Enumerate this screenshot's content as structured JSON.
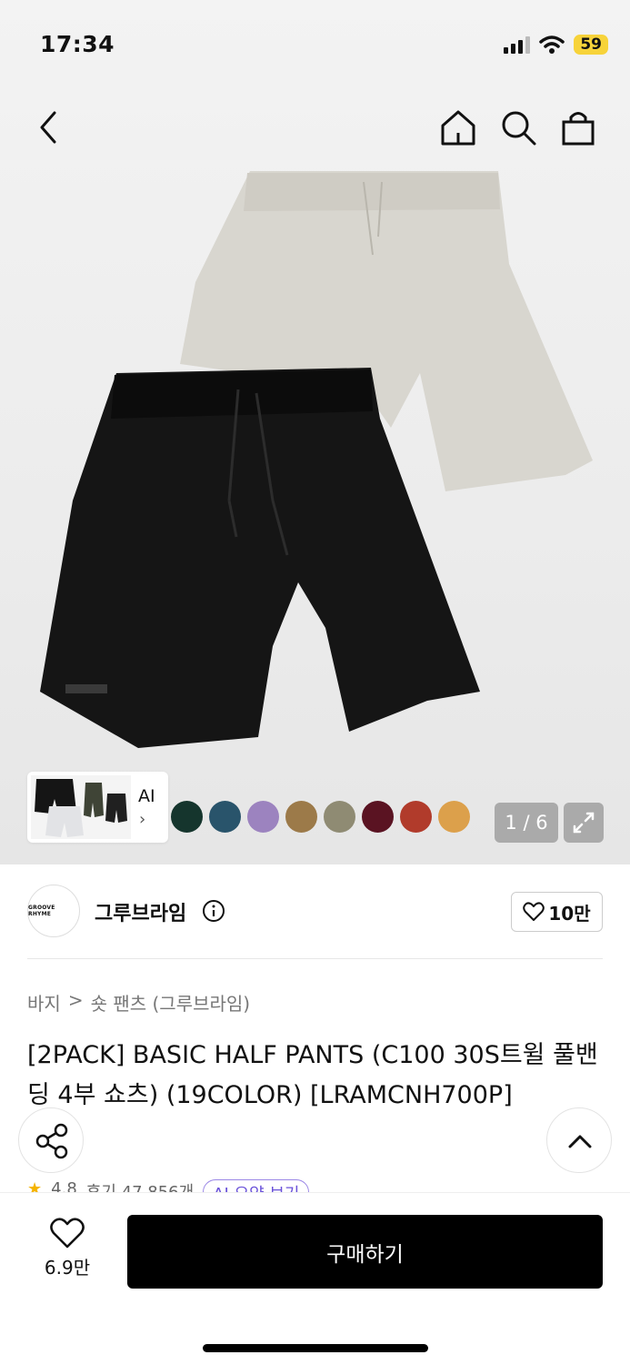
{
  "status_bar": {
    "time": "17:34",
    "battery": "59"
  },
  "nav": {
    "back_icon": "chevron-left-icon",
    "home_icon": "home-icon",
    "search_icon": "search-icon",
    "bag_icon": "shopping-bag-icon"
  },
  "gallery": {
    "thumbnail_label": "AI",
    "counter": "1 / 6",
    "swatch_colors": [
      "#15352d",
      "#29546b",
      "#9c83bf",
      "#9c7a49",
      "#8f8b73",
      "#5a1322",
      "#b13b2b",
      "#dca04b"
    ]
  },
  "brand": {
    "logo_text": "GROOVE RHYME",
    "name": "그루브라임",
    "like_count": "10만"
  },
  "breadcrumb": {
    "level1": "바지",
    "separator": ">",
    "level2": "숏 팬츠 (그루브라임)"
  },
  "product": {
    "title": "[2PACK] BASIC HALF PANTS (C100 30S트윌 풀밴딩 4부 쇼츠) (19COLOR) [LRAMCNH700P]"
  },
  "rating": {
    "score": "4.8",
    "reviews": "후기 47,856개",
    "ai_label": "AI 요약 보기"
  },
  "bottom_bar": {
    "wish_count": "6.9만",
    "buy_label": "구매하기"
  }
}
